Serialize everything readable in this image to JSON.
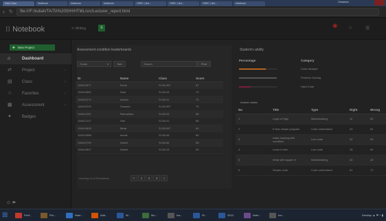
{
  "browser": {
    "tabs": [
      "Data Class",
      "Notebook",
      "Notebook",
      "Notebook",
      "CBRC | Not...",
      "CBRC | Not...",
      "CBRC | Not...",
      "Notebook"
    ],
    "active_tab": 0,
    "user": "Deawdum",
    "url": "file:///F:/kuliah/TA/TA%20SIH/HTML/src/Lecturer_report.html"
  },
  "header": {
    "logo": "Notebook",
    "small_label": "Writing",
    "green_badge": "6",
    "red_icon": "bell-icon"
  },
  "sidebar": {
    "new_project": "New Project",
    "items": [
      {
        "label": "Dashboard",
        "icon": "home-icon",
        "active": true
      },
      {
        "label": "Project",
        "icon": "project-icon",
        "active": false
      },
      {
        "label": "Class",
        "icon": "class-icon",
        "active": false
      },
      {
        "label": "Favorites",
        "icon": "star-icon",
        "active": false
      },
      {
        "label": "Assessment",
        "icon": "chart-icon",
        "active": false
      },
      {
        "label": "Badges",
        "icon": "badge-icon",
        "active": false
      }
    ]
  },
  "leaderboard": {
    "title": "Assessment condition leaderboards",
    "select_value": "Grade",
    "sort_label": "Sort",
    "search_placeholder": "Search",
    "find_label": "Find",
    "columns": [
      "ID",
      "Name",
      "Class",
      "Score"
    ],
    "rows": [
      [
        "110610577",
        "Kevin",
        "SI-36-INT",
        "87"
      ],
      [
        "110612582",
        "Dani",
        "SI-38-04",
        "70"
      ],
      [
        "110612274",
        "Arman",
        "SI-36-01",
        "70"
      ],
      [
        "110612219",
        "Susanto",
        "SI-36-INT",
        "70"
      ],
      [
        "110611322",
        "Ramadhan",
        "SI-38-04",
        "68"
      ],
      [
        "110612127",
        "Sari",
        "SI-38-01",
        "66"
      ],
      [
        "110612828",
        "Bima",
        "SI-38-INT",
        "60"
      ],
      [
        "110612588",
        "Ismail",
        "SI-38-05",
        "60"
      ],
      [
        "110612799",
        "Daniel",
        "SI-38-06",
        "58"
      ],
      [
        "110614507",
        "Daniel",
        "SI-38-03",
        "50"
      ]
    ],
    "footer": "showing 10 of 55 students",
    "pages": [
      "<",
      "1",
      "2",
      "3",
      ">"
    ]
  },
  "ability": {
    "title": "Student's ability",
    "col_percentage": "Percentage",
    "col_category": "Category",
    "items": [
      {
        "percent": 70,
        "color": "#b5651d",
        "category": "Code Analyze"
      },
      {
        "percent": 100,
        "color": "#555555",
        "category": "Problem Solving"
      },
      {
        "percent": 30,
        "color": "#7a1f3a",
        "category": "Hard Code"
      }
    ]
  },
  "answer": {
    "title": "Answer status",
    "columns": [
      "No",
      "Title",
      "Type",
      "Right",
      "Wrong"
    ],
    "rows": [
      [
        "1",
        "Logic of Sign",
        "Matchmaking",
        "11",
        "50"
      ],
      [
        "2",
        "If else simple program",
        "Code understand",
        "20",
        "61"
      ],
      [
        "3",
        "make looping with condition",
        "Live code",
        "32",
        "53"
      ],
      [
        "4",
        "Learn if else",
        "Live code",
        "35",
        "60"
      ],
      [
        "5",
        "What will happen if",
        "Matchmaking",
        "40",
        "40"
      ],
      [
        "6",
        "Simple code",
        "Code understand",
        "61",
        "72"
      ]
    ]
  },
  "taskbar": {
    "items": [
      "Firef...",
      "Pro...",
      "Note...",
      "Adit...",
      "W...",
      "Mo...",
      "Ins...",
      "W...",
      "2013",
      "Note...",
      "Ins..."
    ],
    "tray": "Desktop"
  }
}
